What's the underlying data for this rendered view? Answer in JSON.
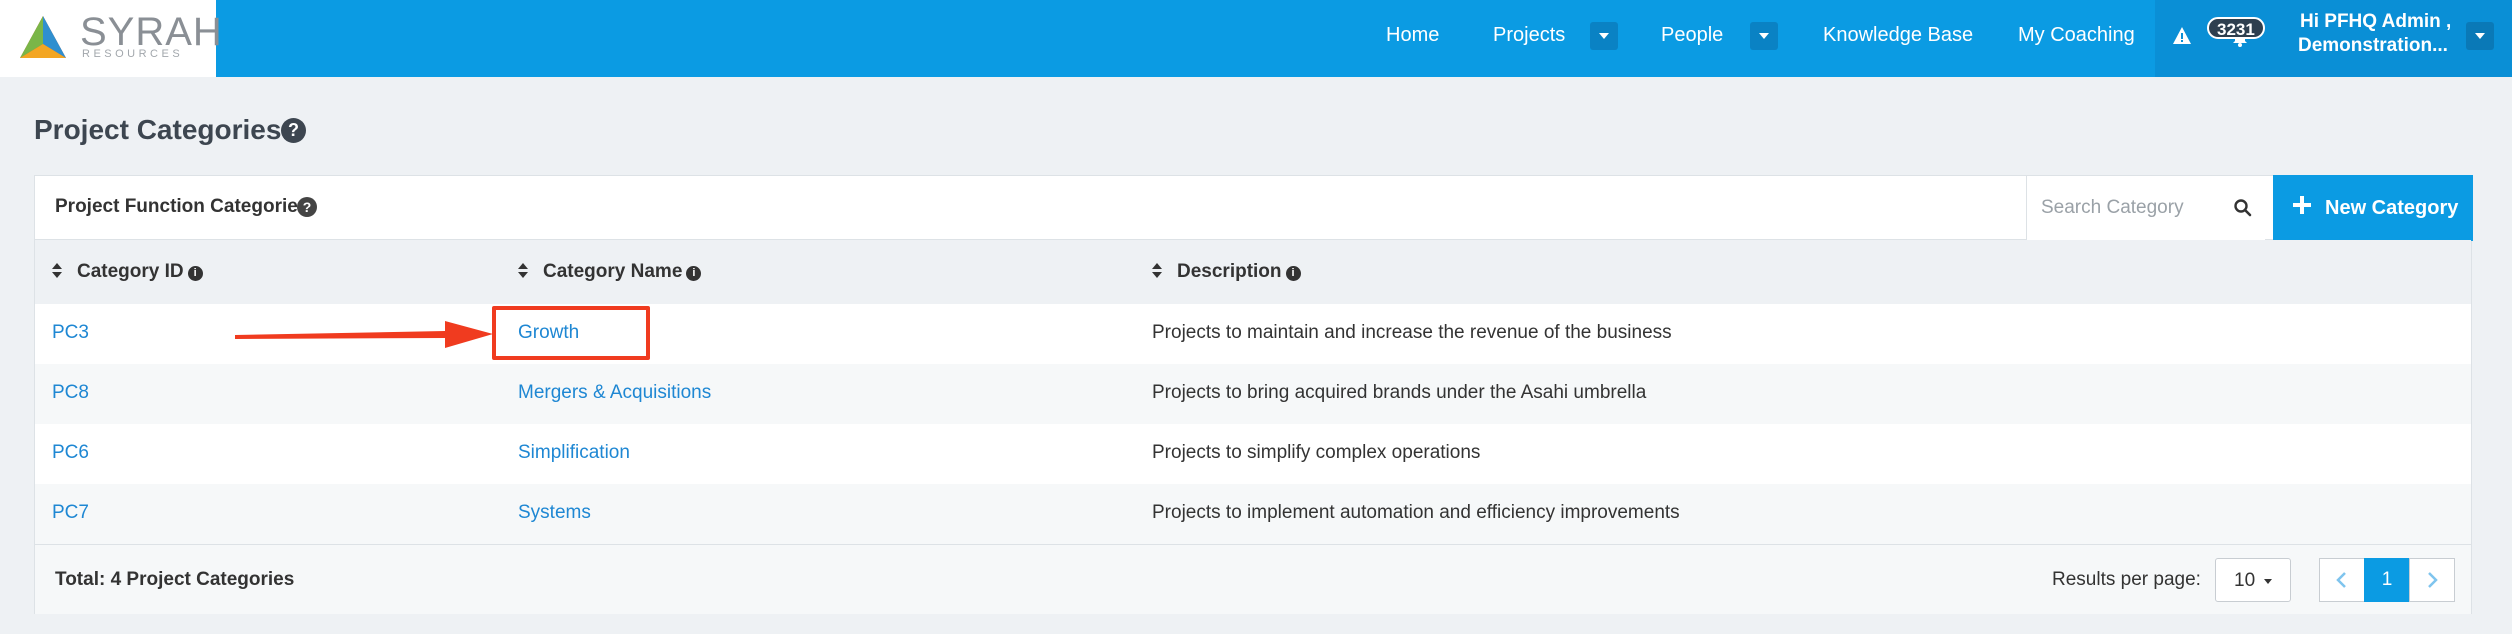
{
  "brand": {
    "name": "SYRAH",
    "tagline": "RESOURCES"
  },
  "nav": {
    "items": [
      {
        "label": "Home"
      },
      {
        "label": "Projects"
      },
      {
        "label": "People"
      },
      {
        "label": "Knowledge Base"
      },
      {
        "label": "My Coaching"
      }
    ],
    "notification_count": "3231",
    "user_greeting": "Hi PFHQ Admin ,",
    "user_org": "Demonstration..."
  },
  "page": {
    "title": "Project Categories:",
    "help_glyph": "?"
  },
  "panel": {
    "title": "Project Function Categories",
    "help_glyph": "?",
    "search_placeholder": "Search Category",
    "new_button_label": "New Category"
  },
  "table": {
    "columns": [
      {
        "label": "Category ID"
      },
      {
        "label": "Category Name"
      },
      {
        "label": "Description"
      }
    ],
    "info_glyph": "i",
    "rows": [
      {
        "id": "PC3",
        "name": "Growth",
        "description": "Projects to maintain and increase the revenue of the business"
      },
      {
        "id": "PC8",
        "name": "Mergers & Acquisitions",
        "description": "Projects to bring acquired brands under the Asahi umbrella"
      },
      {
        "id": "PC6",
        "name": "Simplification",
        "description": "Projects to simplify complex operations"
      },
      {
        "id": "PC7",
        "name": "Systems",
        "description": "Projects to implement automation and efficiency improvements"
      }
    ]
  },
  "footer": {
    "total": "Total: 4 Project Categories",
    "results_per_page_label": "Results per page:",
    "results_per_page_value": "10",
    "current_page": "1"
  },
  "colors": {
    "primary": "#0b9be3",
    "link": "#1e87d3",
    "annotation": "#f03b1f"
  }
}
